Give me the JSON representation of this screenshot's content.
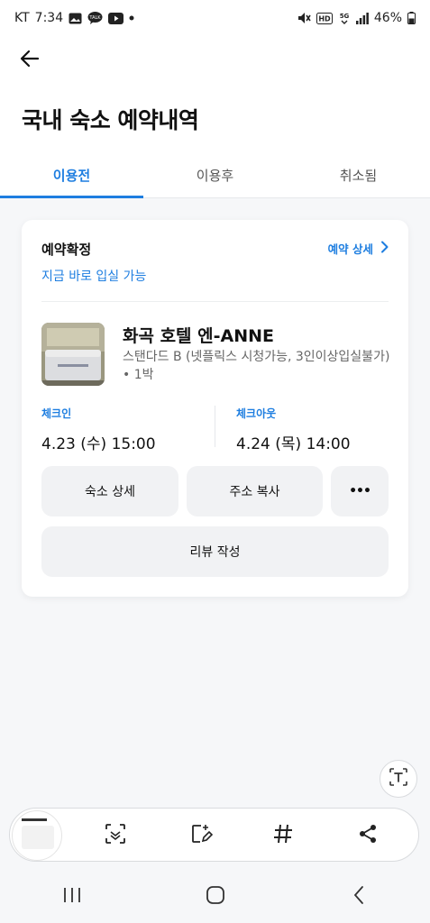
{
  "status_bar": {
    "carrier": "KT",
    "time": "7:34",
    "battery": "46%",
    "icons": [
      "gallery-icon",
      "talk-icon",
      "youtube-icon",
      "dot-icon",
      "mute-icon",
      "hd-icon",
      "5g-icon",
      "signal-icon",
      "battery-icon"
    ]
  },
  "header": {
    "back_icon": "arrow-left-icon",
    "title": "국내 숙소 예약내역",
    "tabs": [
      {
        "label": "이용전",
        "active": true
      },
      {
        "label": "이용후",
        "active": false
      },
      {
        "label": "취소됨",
        "active": false
      }
    ]
  },
  "reservation": {
    "status": "예약확정",
    "status_sub": "지금 바로 입실 가능",
    "detail_link": "예약 상세",
    "hotel_name": "화곡 호텔 엔-ANNE",
    "room_info": "스탠다드 B (넷플릭스 시청가능, 3인이상입실불가) • 1박",
    "checkin_label": "체크인",
    "checkin_value": "4.23 (수) 15:00",
    "checkout_label": "체크아웃",
    "checkout_value": "4.24 (목) 14:00",
    "buttons": {
      "detail": "숙소 상세",
      "copy_address": "주소 복사",
      "more": "•••",
      "review": "리뷰 작성"
    }
  },
  "colors": {
    "accent": "#1e7ee0",
    "background": "#f6f7f9",
    "button_bg": "#f1f2f4"
  },
  "toolbar": {
    "icons": [
      "screenshot-thumbnail",
      "scan-icon",
      "edit-icon",
      "hashtag-icon",
      "share-icon"
    ]
  },
  "float_button": {
    "icon": "text-extract-icon"
  },
  "navbar": {
    "icons": [
      "recents-icon",
      "home-icon",
      "back-icon"
    ]
  }
}
